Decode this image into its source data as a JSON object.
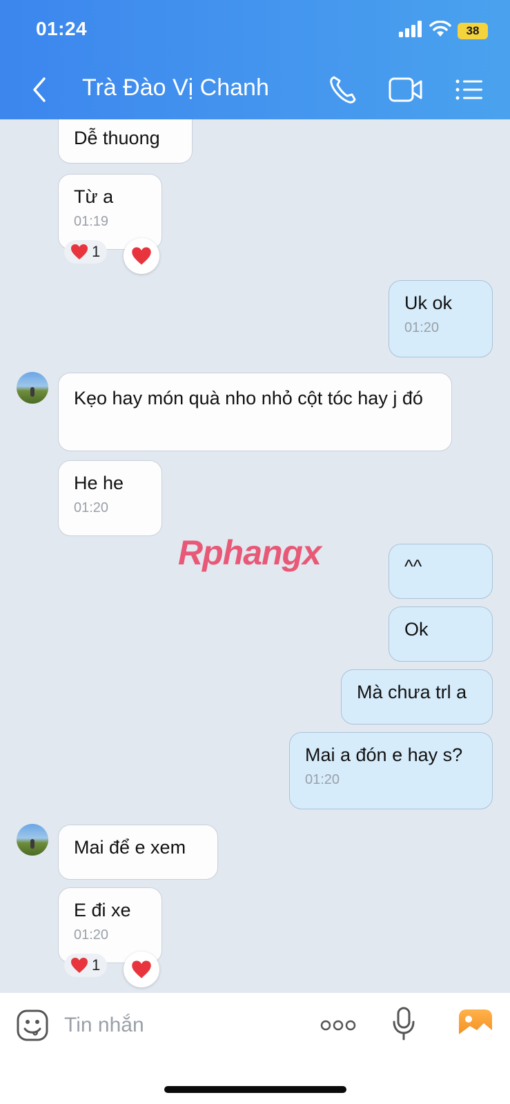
{
  "status_bar": {
    "time": "01:24",
    "battery": "38"
  },
  "header": {
    "title": "Trà Đào Vị Chanh"
  },
  "messages": [
    {
      "text": "Dễ thuong"
    },
    {
      "text": "Từ a",
      "time": "01:19",
      "reaction": "1"
    },
    {
      "text": "Uk ok",
      "time": "01:20"
    },
    {
      "text": "Kẹo hay món quà nho nhỏ cột tóc hay j đó"
    },
    {
      "text": "He he",
      "time": "01:20"
    },
    {
      "text": "^^"
    },
    {
      "text": "Ok"
    },
    {
      "text": "Mà chưa trl a"
    },
    {
      "text": "Mai a đón e hay s?",
      "time": "01:20"
    },
    {
      "text": "Mai để e xem"
    },
    {
      "text": "E đi xe",
      "time": "01:20",
      "reaction": "1"
    }
  ],
  "watermark": "Rphangx",
  "input": {
    "placeholder": "Tin nhắn"
  },
  "colors": {
    "header_start": "#3c86ee",
    "header_end": "#4aa2ee",
    "outgoing_bubble": "#d6ecfb",
    "incoming_bubble": "#fdfdfd",
    "background": "#e2e8f0"
  }
}
